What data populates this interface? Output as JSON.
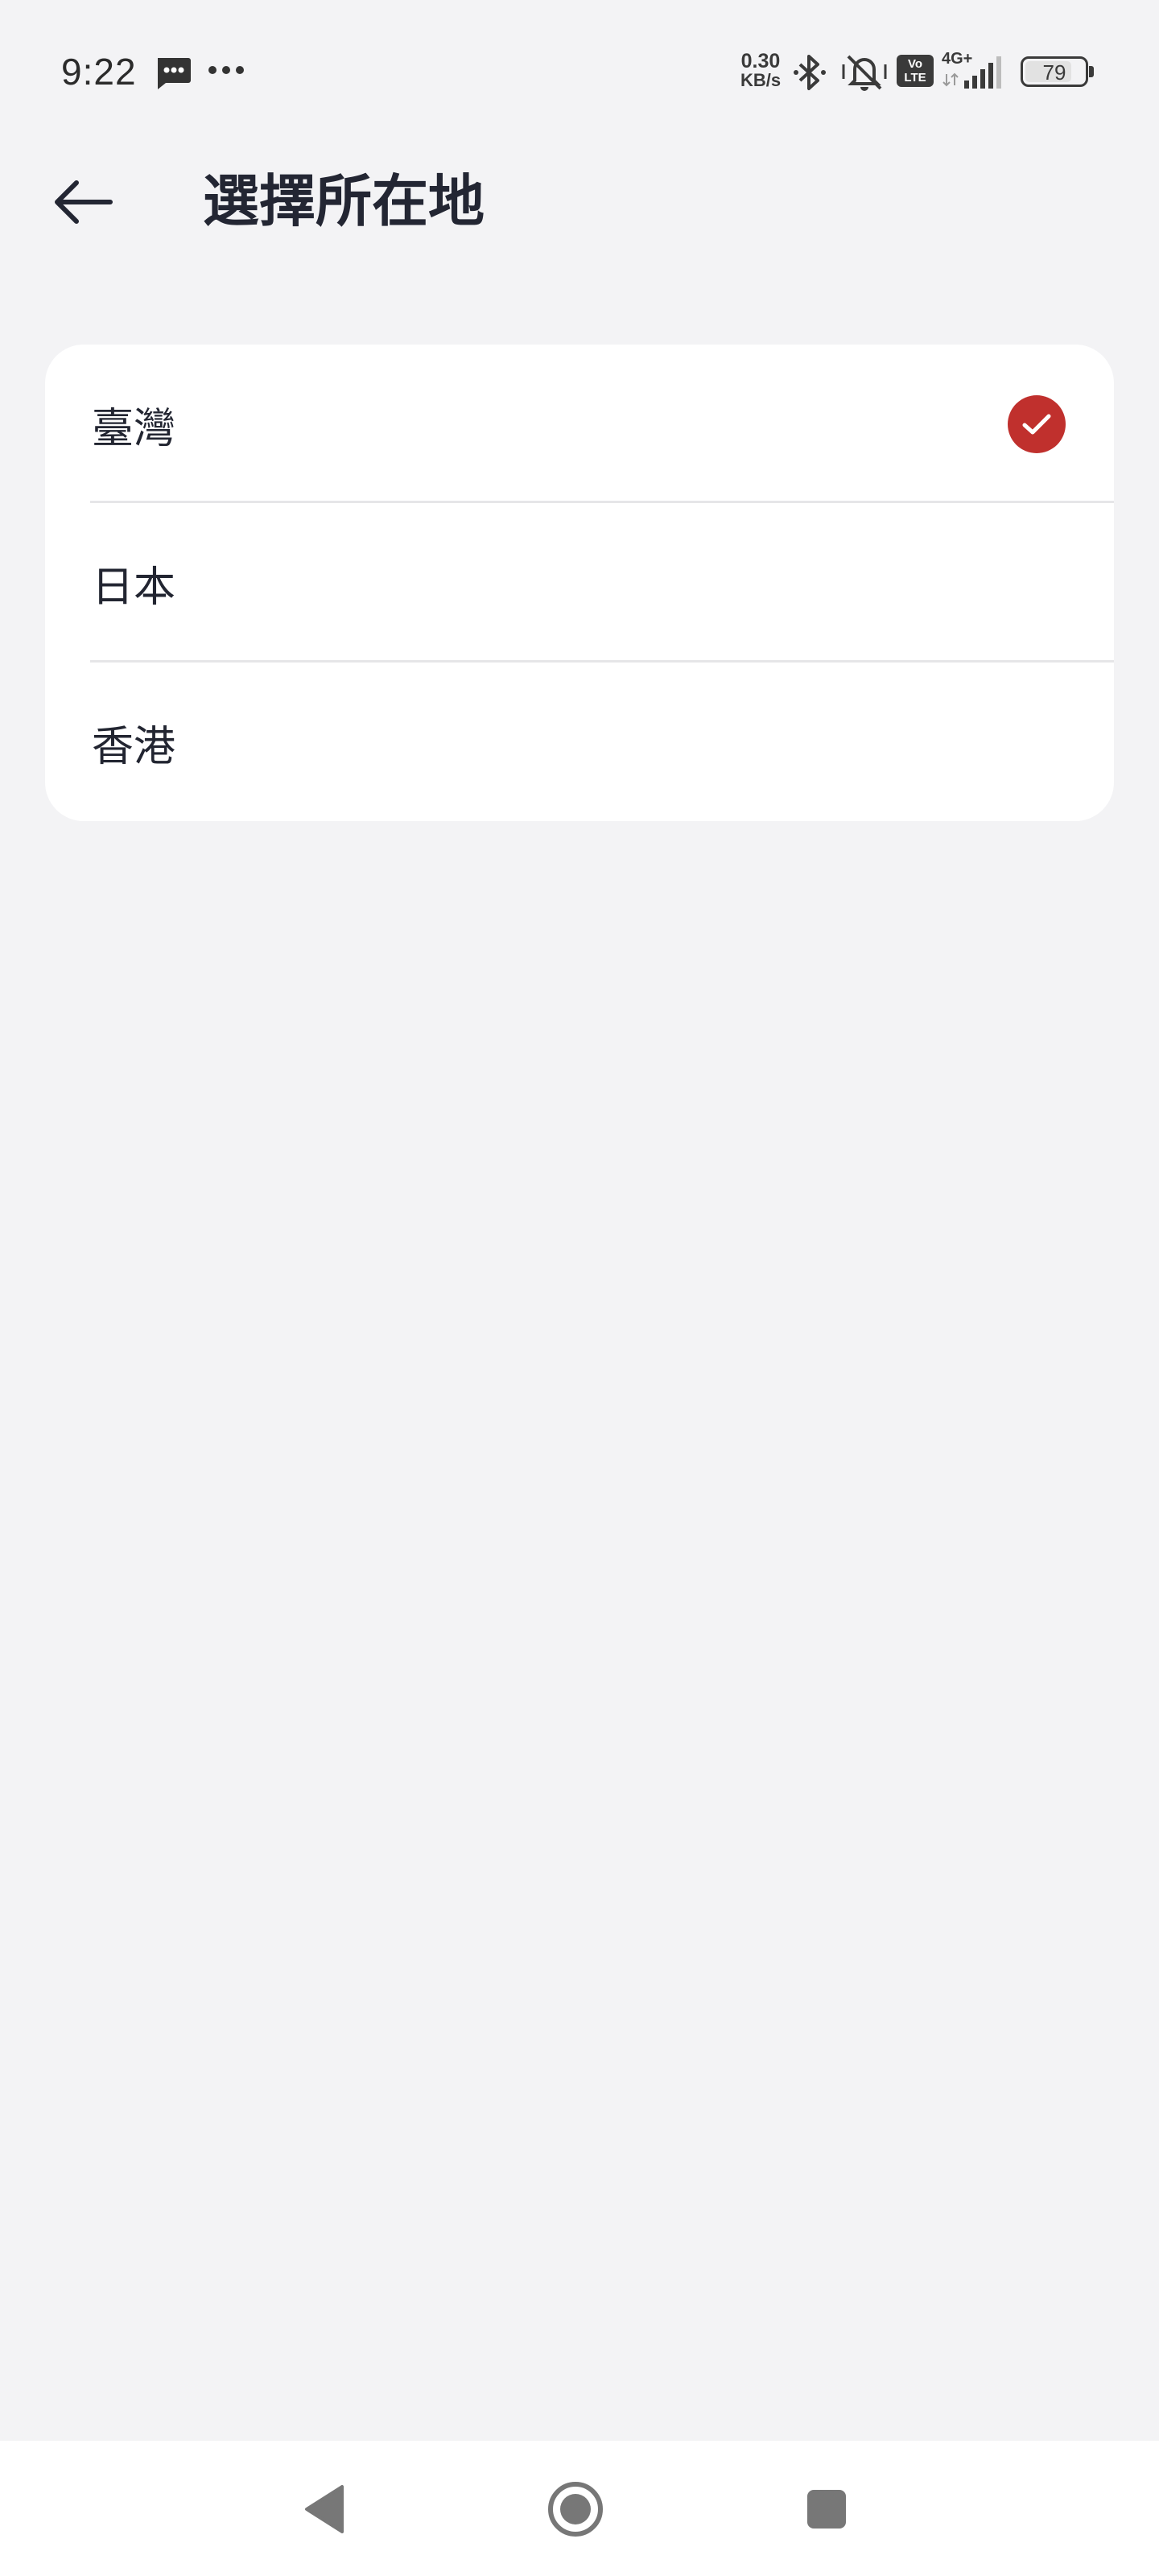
{
  "status_bar": {
    "time": "9:22",
    "net_speed_value": "0.30",
    "net_speed_unit": "KB/s",
    "volte_top": "Vo",
    "volte_bottom": "LTE",
    "network_type": "4G+",
    "battery_level": "79",
    "battery_fraction": 0.79
  },
  "header": {
    "back_icon": "arrow-left-icon",
    "title": "選擇所在地"
  },
  "locations": [
    {
      "label": "臺灣",
      "selected": true
    },
    {
      "label": "日本",
      "selected": false
    },
    {
      "label": "香港",
      "selected": false
    }
  ],
  "colors": {
    "background": "#f3f3f5",
    "card": "#ffffff",
    "accent": "#c0302d",
    "text": "#222531"
  },
  "nav_bar": {
    "icons": [
      "back-triangle-icon",
      "home-circle-icon",
      "recents-square-icon"
    ]
  }
}
